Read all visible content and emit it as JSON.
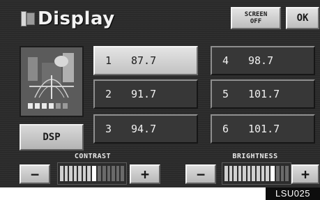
{
  "header": {
    "title": "Display",
    "screen_off_label": "SCREEN\nOFF",
    "ok_label": "OK"
  },
  "dsp": {
    "button_label": "DSP",
    "image_icon": "dsp-sound-field-picture"
  },
  "presets": [
    {
      "num": "1",
      "freq": "87.7",
      "selected": true
    },
    {
      "num": "2",
      "freq": "91.7",
      "selected": false
    },
    {
      "num": "3",
      "freq": "94.7",
      "selected": false
    },
    {
      "num": "4",
      "freq": "98.7",
      "selected": false
    },
    {
      "num": "5",
      "freq": "101.7",
      "selected": false
    },
    {
      "num": "6",
      "freq": "101.7",
      "selected": false
    }
  ],
  "contrast": {
    "label": "CONTRAST",
    "minus": "−",
    "plus": "+",
    "level_fraction": 0.55
  },
  "brightness": {
    "label": "BRIGHTNESS",
    "minus": "−",
    "plus": "+",
    "level_fraction": 0.8
  },
  "figure_code": "LSU025",
  "colors": {
    "screen_bg": "#2a2a2a",
    "button_light": "#d4d4d4",
    "preset_dark": "#373737",
    "text_light": "#f0f0f0"
  }
}
